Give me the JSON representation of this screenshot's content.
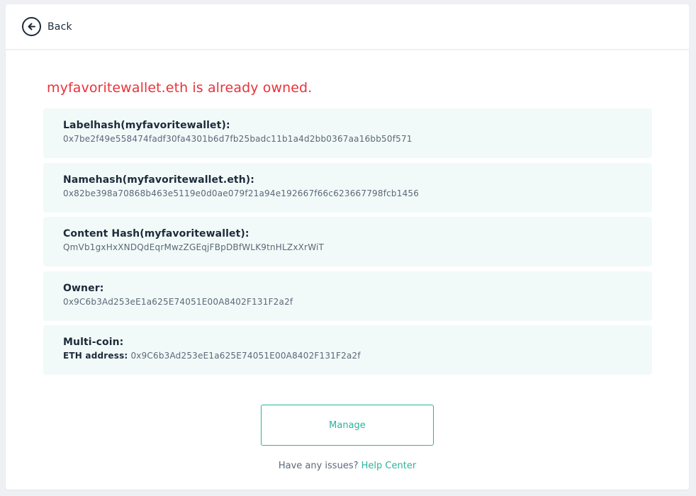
{
  "header": {
    "back_label": "Back",
    "back_icon": "arrow-left-circle-icon"
  },
  "main": {
    "headline": "myfavoritewallet.eth is already owned.",
    "cards": [
      {
        "title": "Labelhash(myfavoritewallet):",
        "value": "0x7be2f49e558474fadf30fa4301b6d7fb25badc11b1a4d2bb0367aa16bb50f571"
      },
      {
        "title": "Namehash(myfavoritewallet.eth):",
        "value": "0x82be398a70868b463e5119e0d0ae079f21a94e192667f66c623667798fcb1456"
      },
      {
        "title": "Content Hash(myfavoritewallet):",
        "value": "QmVb1gxHxXNDQdEqrMwzZGEqjFBpDBfWLK9tnHLZxXrWiT"
      },
      {
        "title": "Owner:",
        "value": "0x9C6b3Ad253eE1a625E74051E00A8402F131F2a2f"
      },
      {
        "title": "Multi-coin:",
        "sub_label": "ETH address:",
        "value": "0x9C6b3Ad253eE1a625E74051E00A8402F131F2a2f"
      }
    ],
    "manage_label": "Manage",
    "help_text": "Have any issues?",
    "help_link": "Help Center"
  },
  "colors": {
    "error_red": "#e9323a",
    "accent_green": "#2bb39b",
    "card_bg": "#f2faf9",
    "page_bg": "#eef0f3"
  }
}
